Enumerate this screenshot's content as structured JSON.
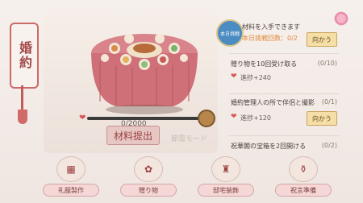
{
  "banner": {
    "title": "婚約"
  },
  "main": {
    "progress": {
      "current": 0,
      "max": 2000,
      "text": "0/2000",
      "fraction": 0.0
    },
    "submit_button": "材料提出",
    "watermark": "節電モード"
  },
  "tasks": [
    {
      "title": "材料を入手できます",
      "subtitle": "本日挑戦回数：0/2",
      "action": "向かう",
      "badge": "本日挑戦"
    },
    {
      "title": "贈り物を10回受け取る",
      "count": "(0/10)",
      "reward": "進捗+240"
    },
    {
      "title": "婚約管理人の所で伴侶と撮影",
      "count": "(0/1)",
      "reward": "進捗+120",
      "action": "向かう"
    },
    {
      "title": "祝華閣の宝箱を2回開ける",
      "count": "(0/2)"
    }
  ],
  "toolbar": {
    "items": [
      {
        "label": "礼服製作"
      },
      {
        "label": "贈り物"
      },
      {
        "label": "邸宅装飾"
      },
      {
        "label": "祝言準備"
      }
    ]
  },
  "colors": {
    "accent": "#d75757",
    "button_gold": "#f5dfa7",
    "panel": "#f6eee8"
  }
}
